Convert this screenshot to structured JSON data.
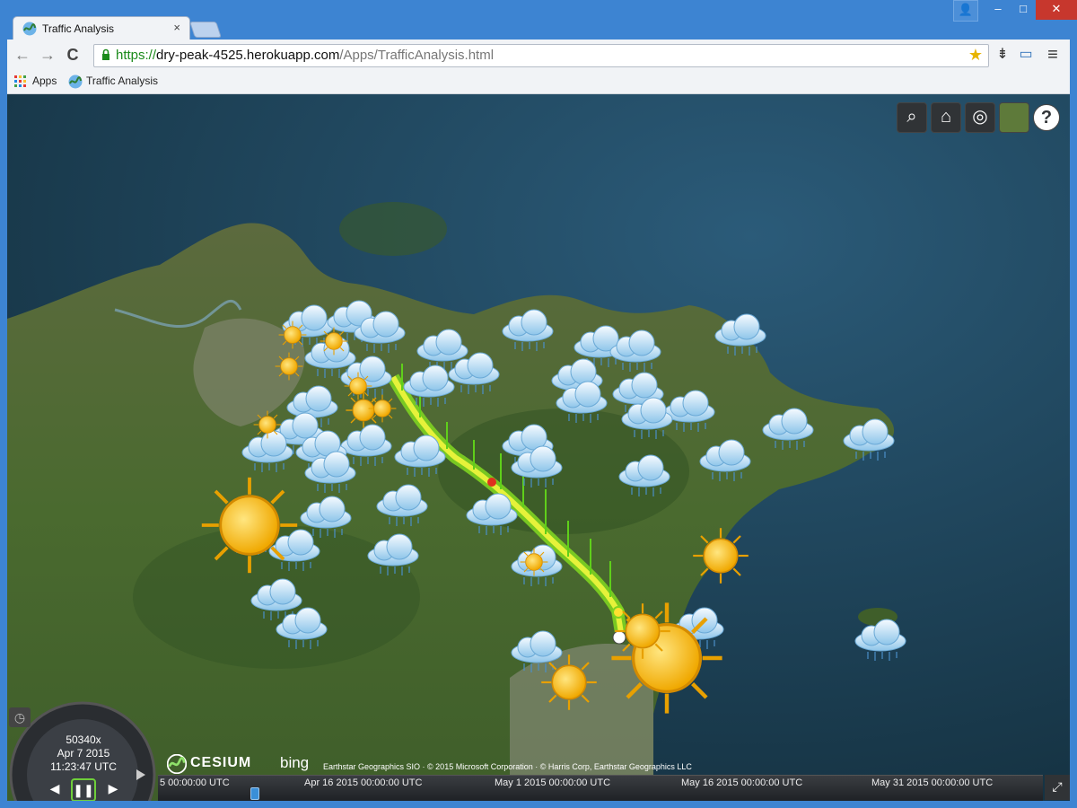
{
  "tab": {
    "title": "Traffic Analysis",
    "close": "×"
  },
  "window": {
    "user": "👤",
    "minimize": "‒",
    "maximize": "□",
    "close": "✕"
  },
  "toolbar": {
    "back": "←",
    "forward": "→",
    "reload": "C",
    "url_scheme": "https://",
    "url_host": "dry-peak-4525.herokuapp.com",
    "url_path": "/Apps/TrafficAnalysis.html",
    "star": "★",
    "ext": "⇟",
    "cast": "▭",
    "menu": "≡"
  },
  "bookmarks": {
    "apps": "Apps",
    "traffic": "Traffic Analysis"
  },
  "cesium_toolbar": {
    "search": "⌕",
    "home": "⌂",
    "globe": "◎",
    "help": "?"
  },
  "animation": {
    "speed": "50340x",
    "date": "Apr 7 2015",
    "time": "11:23:47 UTC"
  },
  "credits": {
    "cesium": "CESIUM",
    "bing": "bing",
    "text": "Earthstar Geographics SIO · © 2015 Microsoft Corporation · © Harris Corp, Earthstar Geographics LLC"
  },
  "timeline": {
    "t0": "5 00:00:00 UTC",
    "t1": "Apr 16 2015 00:00:00 UTC",
    "t2": "May 1 2015 00:00:00 UTC",
    "t3": "May 16 2015 00:00:00 UTC",
    "t4": "May 31 2015 00:00:00 UTC"
  },
  "colors": {
    "window": "#3d84d2",
    "chrome": "#f1f3f6",
    "close": "#c7372d",
    "url_green": "#1a8a1a"
  }
}
